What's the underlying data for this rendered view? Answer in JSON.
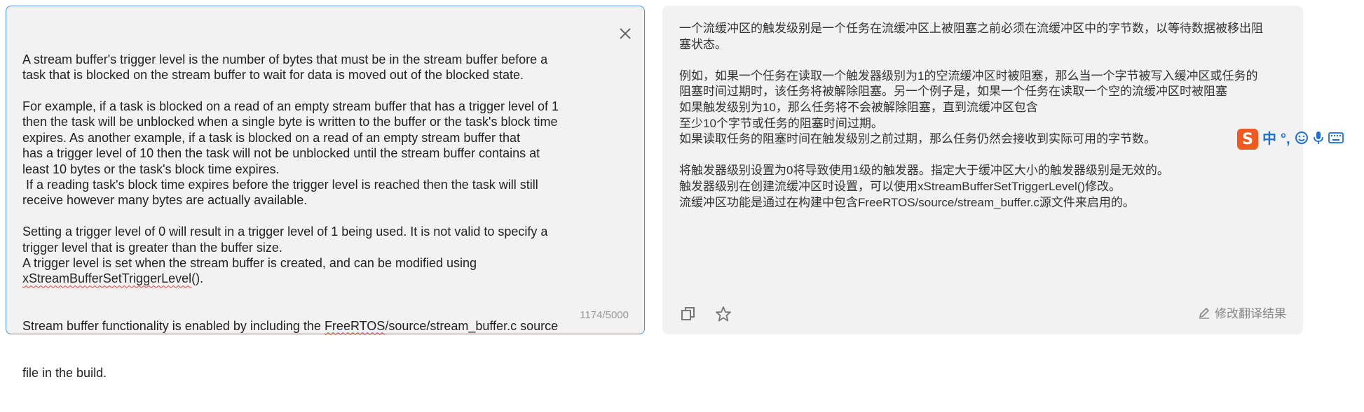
{
  "source": {
    "lines": [
      "A stream buffer's trigger level is the number of bytes that must be in the stream buffer before a",
      "task that is blocked on the stream buffer to wait for data is moved out of the blocked state.",
      "",
      "For example, if a task is blocked on a read of an empty stream buffer that has a trigger level of 1",
      "then the task will be unblocked when a single byte is written to the buffer or the task's block time",
      "expires. As another example, if a task is blocked on a read of an empty stream buffer that",
      "has a trigger level of 10 then the task will not be unblocked until the stream buffer contains at",
      "least 10 bytes or the task's block time expires.",
      " If a reading task's block time expires before the trigger level is reached then the task will still",
      "receive however many bytes are actually available.",
      "",
      "Setting a trigger level of 0 will result in a trigger level of 1 being used. It is not valid to specify a",
      "trigger level that is greater than the buffer size.",
      "A trigger level is set when the stream buffer is created, and can be modified using"
    ],
    "api_fn": "xStreamBufferSetTriggerLevel",
    "api_suffix": "().",
    "last_prefix": "Stream buffer functionality is enabled by including the ",
    "last_link": "FreeRTOS",
    "last_suffix": "/source/stream_buffer.c source",
    "last_line": "file in the build.",
    "char_count": "1174/5000"
  },
  "result": {
    "lines": [
      "一个流缓冲区的触发级别是一个任务在流缓冲区上被阻塞之前必须在流缓冲区中的字节数，以等待数据被移出阻",
      "塞状态。",
      "",
      "例如，如果一个任务在读取一个触发器级别为1的空流缓冲区时被阻塞，那么当一个字节被写入缓冲区或任务的",
      "阻塞时间过期时，该任务将被解除阻塞。另一个例子是，如果一个任务在读取一个空的流缓冲区时被阻塞",
      "如果触发级别为10，那么任务将不会被解除阻塞，直到流缓冲区包含",
      "至少10个字节或任务的阻塞时间过期。",
      "如果读取任务的阻塞时间在触发级别之前过期，那么任务仍然会接收到实际可用的字节数。",
      "",
      "将触发器级别设置为0将导致使用1级的触发器。指定大于缓冲区大小的触发器级别是无效的。",
      "触发器级别在创建流缓冲区时设置，可以使用xStreamBufferSetTriggerLevel()修改。",
      "流缓冲区功能是通过在构建中包含FreeRTOS/source/stream_buffer.c源文件来启用的。"
    ],
    "edit_label": "修改翻译结果"
  },
  "ime": {
    "logo": "S",
    "lang": "中",
    "punct": "°,"
  },
  "colors": {
    "focus_border": "#4a90e2",
    "panel_bg": "#f2f2f2",
    "ime_brand": "#f05a22",
    "ime_blue": "#1a6fd8"
  }
}
